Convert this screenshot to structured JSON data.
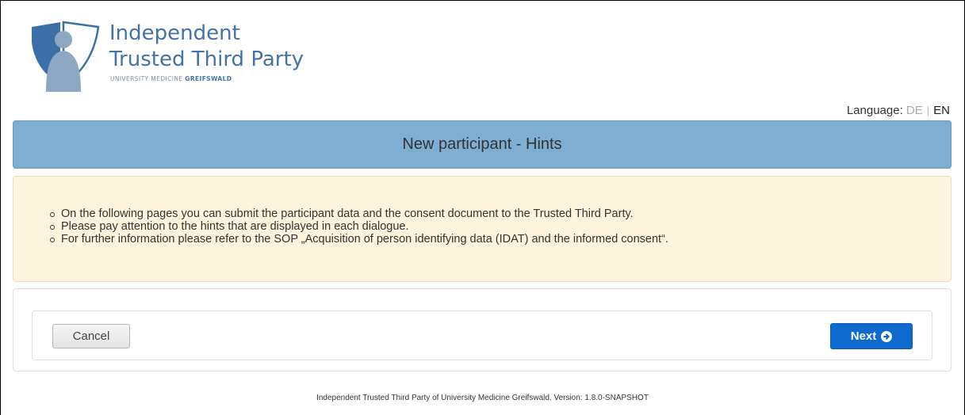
{
  "logo": {
    "line1": "Independent",
    "line2": "Trusted Third Party",
    "sub_light": "UNIVERSITY MEDICINE ",
    "sub_bold": "GREIFSWALD"
  },
  "language": {
    "label": "Language:",
    "options": [
      "DE",
      "EN"
    ],
    "selected": "EN"
  },
  "header": {
    "title": "New participant - Hints"
  },
  "hints": [
    "On the following pages you can submit the participant data and the consent document to the Trusted Third Party.",
    "Please pay attention to the hints that are displayed in each dialogue.",
    "For further information please refer to the SOP „Acquisition of person identifying data (IDAT) and the informed consent“."
  ],
  "buttons": {
    "cancel": "Cancel",
    "next": "Next",
    "next_icon": "arrow-circle-right-icon"
  },
  "footer": {
    "text": "Independent Trusted Third Party of University Medicine Greifswald. Version: 1.8.0-SNAPSHOT"
  },
  "colors": {
    "header_bg": "#7eaed2",
    "hints_bg": "#fcf4dc",
    "primary_button": "#0d6bcf",
    "logo_blue": "#4472a8"
  }
}
